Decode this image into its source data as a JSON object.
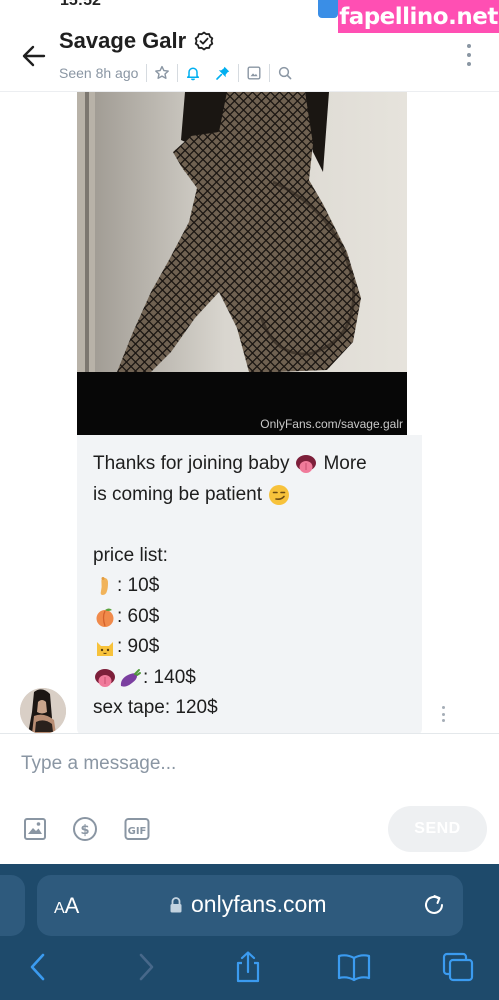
{
  "status_bar": {
    "time": "15:52",
    "watermark": "fapellino.net"
  },
  "header": {
    "title": "Savage Galr",
    "seen": "Seen 8h ago",
    "icons": [
      "star-icon",
      "bell-icon",
      "pin-icon",
      "image-icon",
      "search-icon"
    ]
  },
  "media": {
    "watermark": "OnlyFans.com/savage.galr"
  },
  "message": {
    "line1": "Thanks for joining baby",
    "line1_tail": "More",
    "line2": "is coming be patient",
    "line4": "price list:",
    "item1": ": 10$",
    "item2": ": 60$",
    "item3": ": 90$",
    "item4": ": 140$",
    "item5": "sex tape: 120$"
  },
  "composer": {
    "placeholder": "Type a message...",
    "send_label": "SEND"
  },
  "browser": {
    "aa_small": "A",
    "aa_large": "A",
    "url": "onlyfans.com"
  },
  "colors": {
    "accent": "#00aff0",
    "browser_bg": "#1e4a6b",
    "watermark_bg": "#ff4fb3"
  }
}
